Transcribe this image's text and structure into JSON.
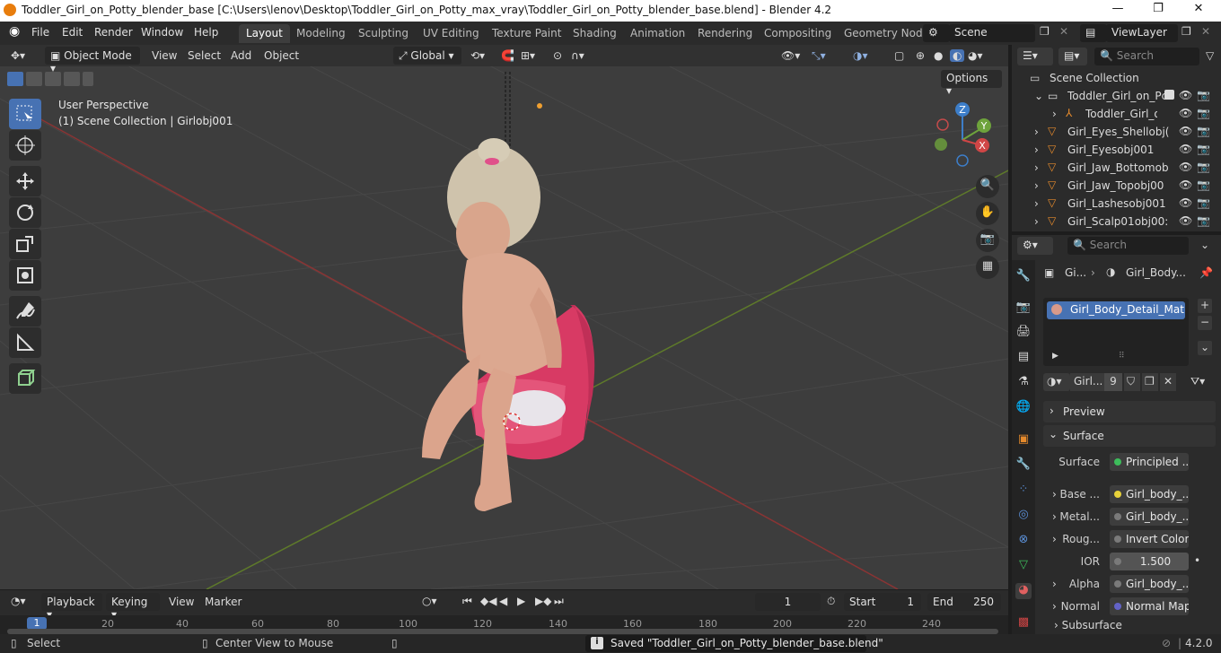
{
  "window": {
    "title": "Toddler_Girl_on_Potty_blender_base [C:\\Users\\lenov\\Desktop\\Toddler_Girl_on_Potty_max_vray\\Toddler_Girl_on_Potty_blender_base.blend] - Blender 4.2",
    "minimize": "—",
    "maximize": "❐",
    "close": "✕"
  },
  "menu": [
    "File",
    "Edit",
    "Render",
    "Window",
    "Help"
  ],
  "workspaces": [
    "Layout",
    "Modeling",
    "Sculpting",
    "UV Editing",
    "Texture Paint",
    "Shading",
    "Animation",
    "Rendering",
    "Compositing",
    "Geometry Nod"
  ],
  "scene": {
    "name": "Scene",
    "view_layer": "ViewLayer"
  },
  "viewport_header": {
    "mode": "Object Mode",
    "menus": [
      "View",
      "Select",
      "Add",
      "Object"
    ],
    "transform": "Global",
    "options": "Options"
  },
  "viewport": {
    "perspective": "User Perspective",
    "collection_info": "(1) Scene Collection | Girlobj001",
    "gizmo_axes": [
      "Z",
      "Y",
      "X"
    ]
  },
  "outliner": {
    "search_placeholder": "Search",
    "root": "Scene Collection",
    "items": [
      {
        "label": "Toddler_Girl_on_Pc"
      },
      {
        "label": "Toddler_Girl_or"
      },
      {
        "label": "Girl_Eyes_Shellobj("
      },
      {
        "label": "Girl_Eyesobj001"
      },
      {
        "label": "Girl_Jaw_Bottomob"
      },
      {
        "label": "Girl_Jaw_Topobj00"
      },
      {
        "label": "Girl_Lashesobj001"
      },
      {
        "label": "Girl_Scalp01obj00:"
      }
    ]
  },
  "properties": {
    "search_placeholder": "Search",
    "breadcrumb_obj": "Gi...",
    "breadcrumb_mat": "Girl_Body...",
    "material_slot": "Girl_Body_Detail_Mat...",
    "material_name": "Girl...",
    "user_count": "9",
    "panels": {
      "preview": "Preview",
      "surface": "Surface",
      "subsurface": "Subsurface"
    },
    "rows": [
      {
        "label": "Surface",
        "value": "Principled ...",
        "color": "#3dbc5b",
        "chevron": false
      },
      {
        "label": "Base ...",
        "value": "Girl_body_...",
        "color": "#e8d23a",
        "chevron": true
      },
      {
        "label": "Metal...",
        "value": "Girl_body_...",
        "color": "#7a7a7a",
        "chevron": true
      },
      {
        "label": "Roug...",
        "value": "Invert Color",
        "color": "#7a7a7a",
        "chevron": true
      },
      {
        "label": "IOR",
        "value": "1.500",
        "color": "#7a7a7a",
        "chevron": false
      },
      {
        "label": "Alpha",
        "value": "Girl_body_...",
        "color": "#7a7a7a",
        "chevron": true
      },
      {
        "label": "Normal",
        "value": "Normal Map",
        "color": "#6363c7",
        "chevron": true
      }
    ]
  },
  "timeline": {
    "menus": [
      "Playback",
      "Keying",
      "View",
      "Marker"
    ],
    "current_frame": "1",
    "start_label": "Start",
    "start": "1",
    "end_label": "End",
    "end": "250",
    "ruler": [
      "1",
      "20",
      "40",
      "60",
      "80",
      "100",
      "120",
      "140",
      "160",
      "180",
      "200",
      "220",
      "240"
    ]
  },
  "statusbar": {
    "select": "Select",
    "center": "Center View to Mouse",
    "message": "Saved \"Toddler_Girl_on_Potty_blender_base.blend\"",
    "version": "4.2.0"
  },
  "colors": {
    "accent": "#4772b3",
    "potty": "#e0406a",
    "axis_x": "#c0392b",
    "axis_y": "#7fa82f"
  }
}
